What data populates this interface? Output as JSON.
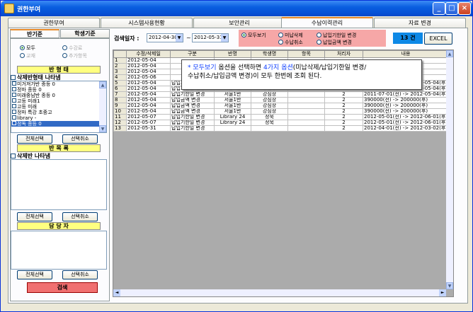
{
  "window": {
    "title": "권한부여"
  },
  "tabs": [
    "권한부여",
    "시스템사용현황",
    "보안관리",
    "수납이력관리",
    "자료 변경"
  ],
  "left": {
    "subtabs": [
      "반기준",
      "학생기준"
    ],
    "radios": [
      {
        "label": "모두",
        "on": true
      },
      {
        "label": "수강료",
        "on": false
      },
      {
        "label": "교재",
        "on": false
      },
      {
        "label": "추가항목",
        "on": false
      }
    ],
    "section1": "반 형 태",
    "check1": "삭제반형태 나타냄",
    "list1": [
      "미거져가반 종등 0",
      "정마 종등 0",
      "미래중남반 종등 0",
      "고등 미래1",
      "고등 미래",
      "정마 특강 초중고",
      "library -",
      "정독 종등 0"
    ],
    "btn_all": "전체선택",
    "btn_cancel": "선택취소",
    "section2": "반 목 록",
    "check2": "삭제반 나타냄",
    "section3": "담 당 자",
    "search": "검색"
  },
  "top": {
    "date_label": "검색일자 :",
    "date_from": "2012-04-30",
    "date_to": "2012-05-31",
    "sep": "~",
    "options": [
      "모두보기",
      "미납삭제",
      "수납취소",
      "납입기한일 변경",
      "납입금액 변경"
    ],
    "count": "13 건",
    "excel": "EXCEL"
  },
  "grid": {
    "headers": [
      "",
      "수정/삭제일",
      "구분",
      "반명",
      "학생명",
      "항목",
      "처리자",
      "내용"
    ],
    "rows": [
      [
        "1",
        "2012-05-04",
        "",
        "",
        "",
        "",
        "",
        ""
      ],
      [
        "2",
        "2012-05-04",
        "",
        "",
        "",
        "",
        "",
        ""
      ],
      [
        "3",
        "2012-05-04",
        "",
        "",
        "",
        "",
        "",
        ""
      ],
      [
        "4",
        "2012-05-06",
        "",
        "",
        "",
        "",
        "",
        ""
      ],
      [
        "5",
        "2012-05-04",
        "납입기한일 변경",
        "서울1반",
        "강심장",
        "",
        "2",
        "2011-07-01(전) -> 2012-05-04(후)"
      ],
      [
        "6",
        "2012-05-04",
        "납입기한일 변경",
        "서울1반",
        "강심장",
        "",
        "2",
        "2011-07-01(전) -> 2012-05-04(후)"
      ],
      [
        "7",
        "2012-05-04",
        "납입기한일 변경",
        "서울1반",
        "강심장",
        "",
        "2",
        "2011-07-01(전) -> 2012-05-04(후)"
      ],
      [
        "8",
        "2012-05-04",
        "납입금액 변경",
        "서울1반",
        "강심장",
        "",
        "2",
        "390000(전) -> 200000(후)"
      ],
      [
        "9",
        "2012-05-04",
        "납입금액 변경",
        "서울1반",
        "강심장",
        "",
        "2",
        "390000(전) -> 200000(후)"
      ],
      [
        "10",
        "2012-05-04",
        "납입금액 변경",
        "서울1반",
        "강심장",
        "",
        "2",
        "390000(전) -> 200000(후)"
      ],
      [
        "11",
        "2012-05-07",
        "납입기한일 변경",
        "Library 24",
        "정욱",
        "",
        "2",
        "2012-05-01(전) -> 2012-06-01(후)"
      ],
      [
        "12",
        "2012-05-07",
        "납입기한일 변경",
        "Library 24",
        "정욱",
        "",
        "2",
        "2012-05-01(전) -> 2012-06-01(후)"
      ],
      [
        "13",
        "2012-05-31",
        "납입기한일 변경",
        "",
        "",
        "",
        "2",
        "2012-04-01(전) -> 2012-03-02(후)"
      ]
    ]
  },
  "tooltip": {
    "a": "* ",
    "b": "모두보기",
    "c": " 옵션을 선택하면 ",
    "d": "4가지 옵션",
    "e": "(미납삭제/납입기한일 변경/",
    "f": "수납취소/납입금액 변경)이 모두 한번에 조회 된다."
  }
}
